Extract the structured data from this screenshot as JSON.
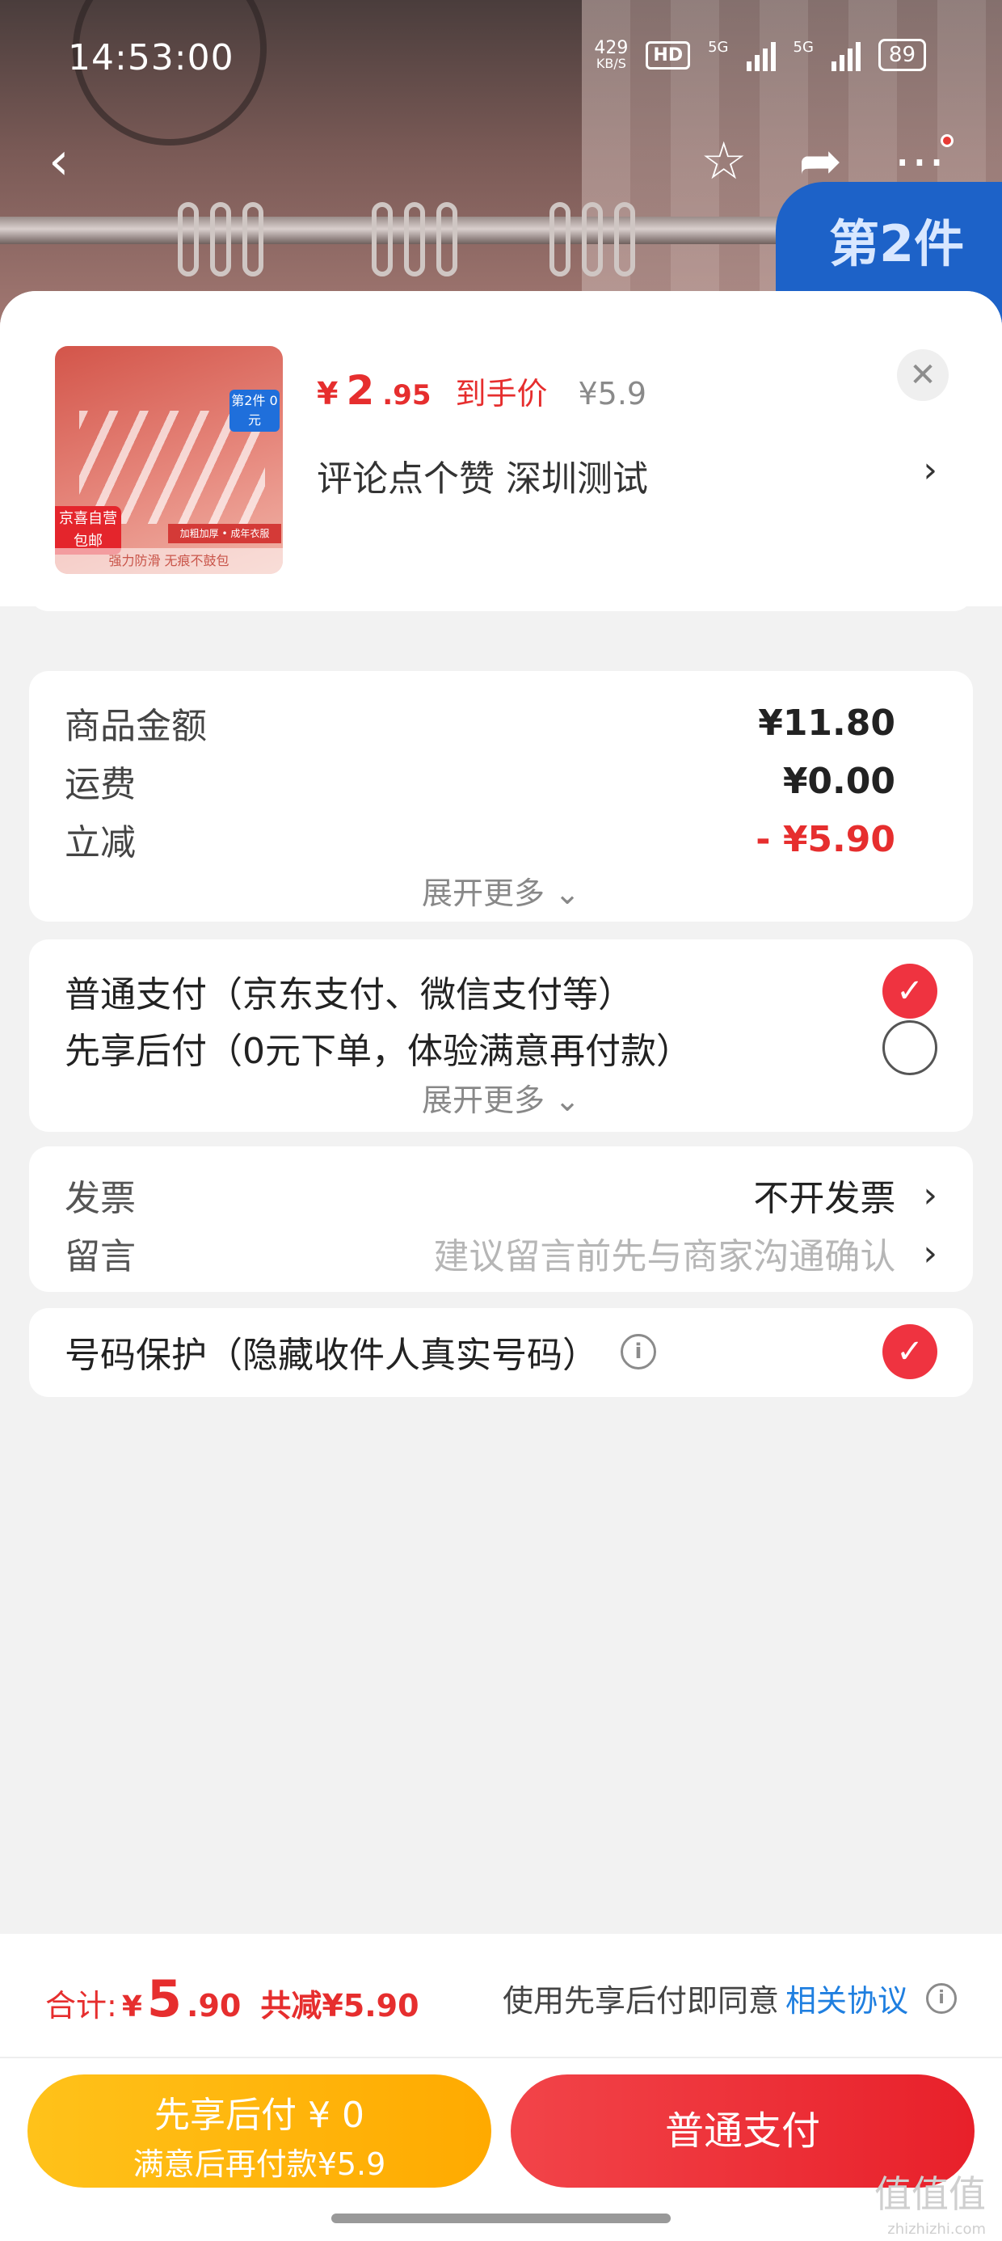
{
  "status_bar": {
    "time": "14:53:00",
    "net_speed": "429",
    "net_unit": "KB/S",
    "hd": "HD",
    "sig1": "5G",
    "sig2": "5G",
    "battery": "89"
  },
  "promo_badge": "第2件",
  "product": {
    "price_symbol": "¥",
    "price_int": "2",
    "price_dec": ".95",
    "arrival_label": "到手价",
    "original_price": "¥5.9",
    "spec": "评论点个赞  深圳测试",
    "thumb_tag": "第2件 0元",
    "thumb_free": "京喜自营 包邮",
    "thumb_strip": "强力防滑 无痕不鼓包",
    "thumb_strip2": "加粗加厚 • 成年衣服"
  },
  "amounts": {
    "rows": [
      {
        "label": "商品金额",
        "value": "¥11.80"
      },
      {
        "label": "运费",
        "value": "¥0.00"
      },
      {
        "label": "立减",
        "value": "- ¥5.90"
      }
    ],
    "expand": "展开更多 ⌄"
  },
  "payment": {
    "options": [
      {
        "label": "普通支付（京东支付、微信支付等）",
        "checked": true
      },
      {
        "label": "先享后付（0元下单，体验满意再付款）",
        "checked": false
      }
    ],
    "expand": "展开更多 ⌄"
  },
  "invoice": {
    "label": "发票",
    "value": "不开发票",
    "message_label": "留言",
    "message_placeholder": "建议留言前先与商家沟通确认"
  },
  "phone_protect": {
    "label": "号码保护（隐藏收件人真实号码）",
    "checked": true
  },
  "footer": {
    "total_label": "合计:",
    "total_symbol": "¥",
    "total_int": "5",
    "total_dec": ".90",
    "saved": "共减¥5.90",
    "agree_text": "使用先享后付即同意",
    "agree_link": "相关协议",
    "btn_later_line1": "先享后付 ¥ 0",
    "btn_later_line2": "满意后再付款¥5.9",
    "btn_pay": "普通支付"
  },
  "watermark": {
    "main": "值值值",
    "sub": "zhizhizhi.com"
  }
}
